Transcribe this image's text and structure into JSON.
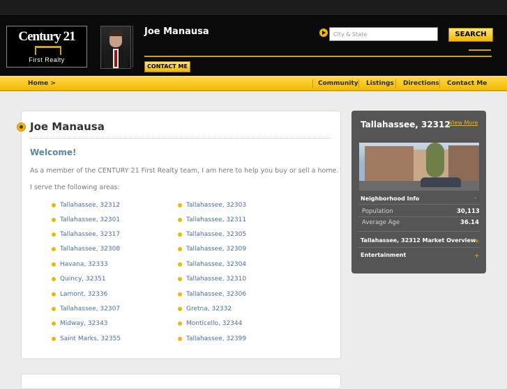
{
  "header": {
    "logo_brand": "Century 21",
    "logo_sub": "First Realty",
    "agent_name": "Joe Manausa",
    "contact_button": "CONTACT ME",
    "search_placeholder": "City & State",
    "search_button": "SEARCH",
    "icons": [
      "agent-photo",
      "roof-icon",
      "play-arrow-icon"
    ]
  },
  "nav": {
    "home": "Home >",
    "items": [
      "Community",
      "Listings",
      "Directions",
      "Contact Me"
    ]
  },
  "main": {
    "title": "Joe Manausa",
    "welcome": "Welcome!",
    "intro": "As a member of the CENTURY 21 First Realty team, I am here to help you buy or sell a home.",
    "areas_intro": "I serve the following areas:",
    "areas_left": [
      "Tallahassee, 32312",
      "Tallahassee, 32301",
      "Tallahassee, 32317",
      "Tallahassee, 32308",
      "Havana, 32333",
      "Quincy, 32351",
      "Lamont, 32336",
      "Tallahassee, 32307",
      "Midway, 32343",
      "Saint Marks, 32355"
    ],
    "areas_right": [
      "Tallahassee, 32303",
      "Tallahassee, 32311",
      "Tallahassee, 32305",
      "Tallahassee, 32309",
      "Tallahassee, 32304",
      "Tallahassee, 32310",
      "Tallahassee, 32306",
      "Gretna, 32332",
      "Monticello, 32344",
      "Tallahassee, 32399"
    ]
  },
  "sidebar": {
    "title": "Tallahassee, 32312",
    "view_more": "View More",
    "neighborhood_label": "Neighborhood Info",
    "neighborhood_toggle": "-",
    "population_label": "Population",
    "population_value": "30,113",
    "age_label": "Average Age",
    "age_value": "36.14",
    "market_label": "Tallahassee, 32312 Market Overview",
    "market_toggle": "+",
    "entertainment_label": "Entertainment",
    "entertainment_toggle": "+"
  },
  "colors": {
    "accent_gold": "#f1b700",
    "header_black": "#0b0b0b",
    "link_blue": "#4a6fa0",
    "welcome_blue": "#5c86a8",
    "sidebar_gray": "#555555"
  }
}
